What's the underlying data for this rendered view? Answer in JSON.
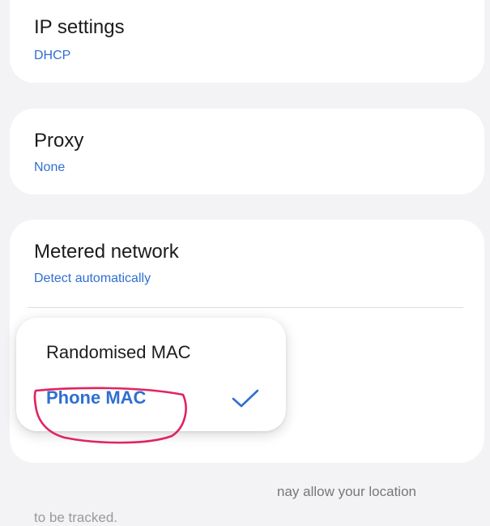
{
  "settings": {
    "ip": {
      "title": "IP settings",
      "value": "DHCP"
    },
    "proxy": {
      "title": "Proxy",
      "value": "None"
    },
    "metered": {
      "title": "Metered network",
      "value": "Detect automatically"
    },
    "partial_text_line1": "nay allow your location",
    "partial_text_line2": "to be tracked."
  },
  "mac_menu": {
    "options": [
      {
        "label": "Randomised MAC",
        "selected": false
      },
      {
        "label": "Phone MAC",
        "selected": true
      }
    ]
  },
  "colors": {
    "accent": "#2f6fd1",
    "annotation": "#e0245e",
    "background": "#f3f3f5",
    "card": "#ffffff"
  },
  "icons": {
    "selected_marker": "check-icon"
  }
}
